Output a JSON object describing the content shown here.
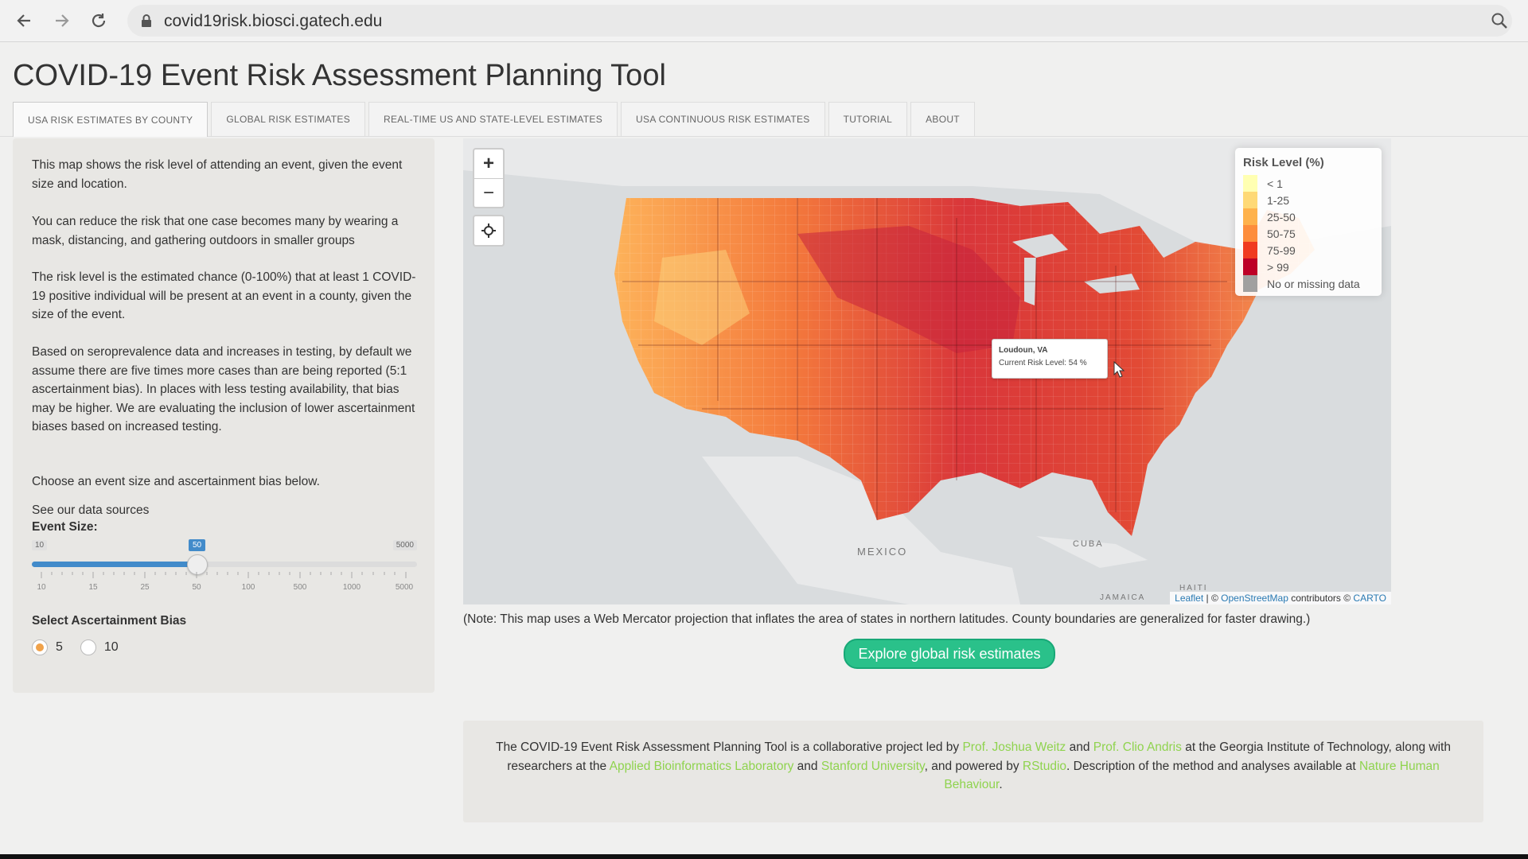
{
  "browser": {
    "url": "covid19risk.biosci.gatech.edu"
  },
  "page": {
    "title": "COVID-19 Event Risk Assessment Planning Tool"
  },
  "tabs": [
    {
      "label": "USA RISK ESTIMATES BY COUNTY",
      "active": true
    },
    {
      "label": "GLOBAL RISK ESTIMATES",
      "active": false
    },
    {
      "label": "REAL-TIME US AND STATE-LEVEL ESTIMATES",
      "active": false
    },
    {
      "label": "USA CONTINUOUS RISK ESTIMATES",
      "active": false
    },
    {
      "label": "TUTORIAL",
      "active": false
    },
    {
      "label": "ABOUT",
      "active": false
    }
  ],
  "sidebar": {
    "para1": "This map shows the risk level of attending an event, given the event size and location.",
    "para2": "You can reduce the risk that one case becomes many by wearing a mask, distancing, and gathering outdoors in smaller groups",
    "para3": "The risk level is the estimated chance (0-100%) that at least 1 COVID-19 positive individual will be present at an event in a county, given the size of the event.",
    "para4": "Based on seroprevalence data and increases in testing, by default we assume there are five times more cases than are being reported (5:1 ascertainment bias). In places with less testing availability, that bias may be higher. We are evaluating the inclusion of lower ascertainment biases based on increased testing.",
    "para5": "Choose an event size and ascertainment bias below.",
    "data_sources_link": "See our data sources",
    "event_size_label": "Event Size:",
    "slider": {
      "min_label": "10",
      "max_label": "5000",
      "current_label": "50",
      "ticks": [
        "10",
        "15",
        "25",
        "50",
        "100",
        "500",
        "1000",
        "5000"
      ]
    },
    "bias_label": "Select Ascertainment Bias",
    "bias_options": [
      {
        "label": "5",
        "selected": true
      },
      {
        "label": "10",
        "selected": false
      }
    ]
  },
  "map": {
    "zoom_in": "+",
    "zoom_out": "−",
    "legend": {
      "title": "Risk Level (%)",
      "items": [
        {
          "label": "< 1",
          "color": "#ffffb2"
        },
        {
          "label": "1-25",
          "color": "#fed976"
        },
        {
          "label": "25-50",
          "color": "#feb24c"
        },
        {
          "label": "50-75",
          "color": "#fd8d3c"
        },
        {
          "label": "75-99",
          "color": "#f03b20"
        },
        {
          "label": "> 99",
          "color": "#bd0026"
        },
        {
          "label": "No or missing data",
          "color": "#a0a0a0"
        }
      ]
    },
    "tooltip": {
      "line1": "Loudoun, VA",
      "line2": "Current Risk Level: 54 %"
    },
    "labels": {
      "mexico": "MEXICO",
      "cuba": "CUBA",
      "jamaica": "JAMAICA",
      "haiti": "HAITI"
    },
    "attribution": {
      "leaflet": "Leaflet",
      "sep1": " | © ",
      "osm": "OpenStreetMap",
      "mid": " contributors © ",
      "carto": "CARTO"
    }
  },
  "note": "(Note: This map uses a Web Mercator projection that inflates the area of states in northern latitudes. County boundaries are generalized for faster drawing.)",
  "cta": "Explore global risk estimates",
  "footer": {
    "t1": "The COVID-19 Event Risk Assessment Planning Tool is a collaborative project led by ",
    "l1": "Prof. Joshua Weitz",
    "t2": " and ",
    "l2": "Prof. Clio Andris",
    "t3": " at the Georgia Institute of Technology, along with researchers at the ",
    "l3": "Applied Bioinformatics Laboratory",
    "t4": " and ",
    "l4": "Stanford University",
    "t5": ", and powered by ",
    "l5": "RStudio",
    "t6": ". Description of the method and analyses available at ",
    "l6": "Nature Human Behaviour",
    "t7": "."
  }
}
